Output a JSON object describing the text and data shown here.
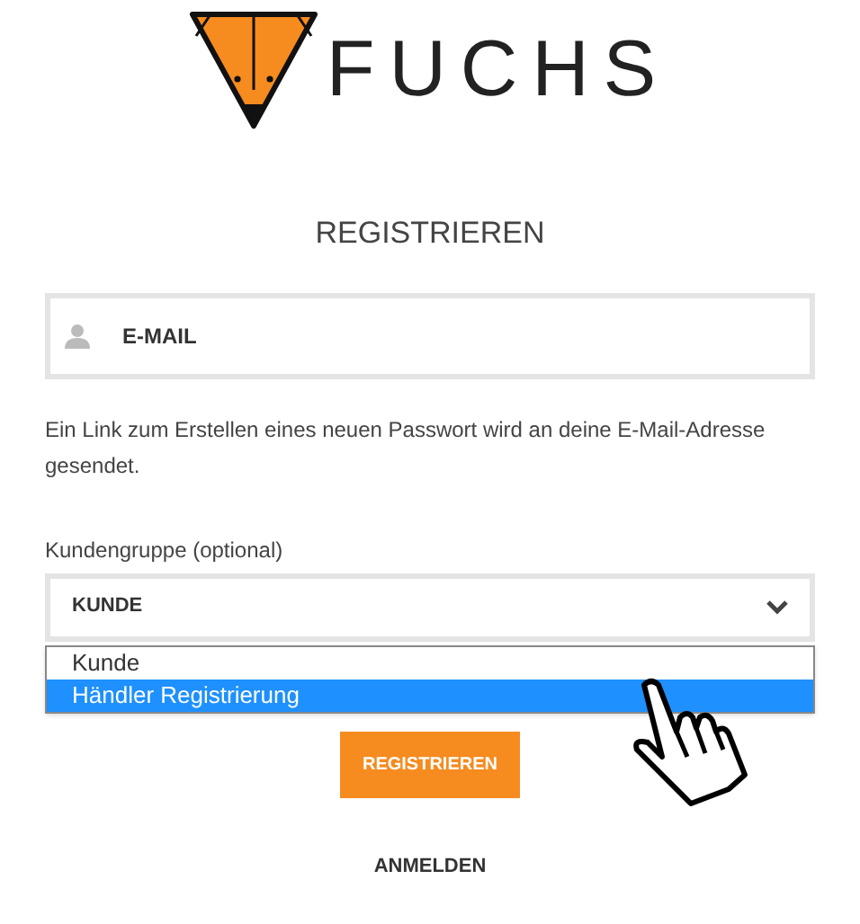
{
  "logo": {
    "text": "FUCHS"
  },
  "title": "REGISTRIEREN",
  "email": {
    "placeholder": "E-MAIL"
  },
  "help_text": "Ein Link zum Erstellen eines neuen Passwort wird an deine E-Mail-Adresse gesendet.",
  "customer_group": {
    "label": "Kundengruppe (optional)",
    "value": "KUNDE",
    "expanded": true,
    "options": [
      {
        "label": "Kunde",
        "selected": false
      },
      {
        "label": "Händler Registrierung",
        "selected": true
      }
    ]
  },
  "submit_button": "REGISTRIEREN",
  "login_link": "ANMELDEN"
}
